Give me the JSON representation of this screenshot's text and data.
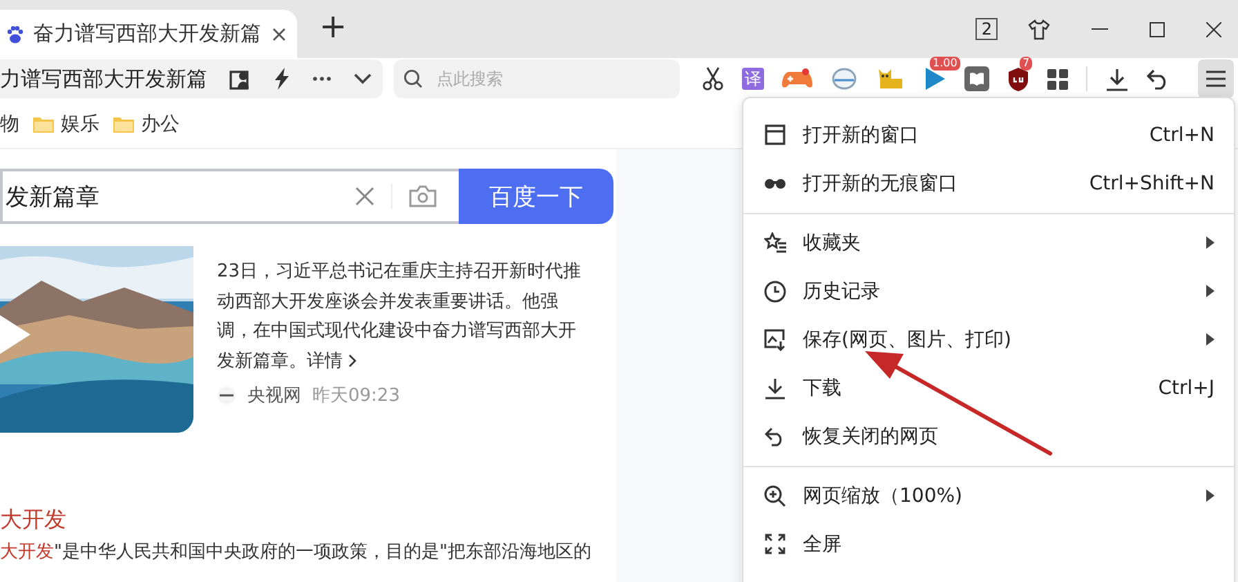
{
  "tab_bar": {
    "tabs": [
      {
        "title": "奋力谱写西部大开发新篇",
        "selected": true
      }
    ],
    "new_tab": "+",
    "tab_count": "2"
  },
  "toolbar": {
    "address": "力谱写西部大开发新篇",
    "search": {
      "placeholder": "点此搜索"
    },
    "extensions": [
      {
        "kind": "scissors"
      },
      {
        "kind": "translate",
        "label": "译"
      },
      {
        "kind": "game"
      },
      {
        "kind": "browser"
      },
      {
        "kind": "cat"
      },
      {
        "kind": "play",
        "badge": "1.00"
      },
      {
        "kind": "book"
      },
      {
        "kind": "shield",
        "badge": "7"
      },
      {
        "kind": "apps"
      }
    ]
  },
  "bookmarks": [
    {
      "label": "物",
      "folder": false
    },
    {
      "label": "娱乐",
      "folder": true
    },
    {
      "label": "办公",
      "folder": true
    }
  ],
  "search": {
    "value": "发新篇章",
    "button": "百度一下"
  },
  "news": {
    "body": "23日，习近平总书记在重庆主持召开新时代推动西部大开发座谈会并发表重要讲话。他强调，在中国式现代化建设中奋力谱写西部大开发新篇章。",
    "link": "详情",
    "source": "央视网",
    "time": "昨天09:23"
  },
  "result": {
    "title": "大开发",
    "highlight": "大开发",
    "snippet": "\"是中华人民共和国中央政府的一项政策，目的是\"把东部沿海地区的"
  },
  "menu": {
    "groups": [
      [
        {
          "kind": "window",
          "label": "打开新的窗口",
          "shortcut": "Ctrl+N",
          "submenu": false
        },
        {
          "kind": "incognito",
          "label": "打开新的无痕窗口",
          "shortcut": "Ctrl+Shift+N",
          "submenu": false
        }
      ],
      [
        {
          "kind": "favorites",
          "label": "收藏夹",
          "submenu": true
        },
        {
          "kind": "history",
          "label": "历史记录",
          "submenu": true
        },
        {
          "kind": "save",
          "label": "保存(网页、图片、打印)",
          "submenu": true
        },
        {
          "kind": "download",
          "label": "下载",
          "shortcut": "Ctrl+J",
          "submenu": false
        },
        {
          "kind": "restore",
          "label": "恢复关闭的网页",
          "submenu": false
        }
      ],
      [
        {
          "kind": "zoom",
          "label": "网页缩放（100%)",
          "submenu": true
        },
        {
          "kind": "fullscreen",
          "label": "全屏",
          "submenu": false
        }
      ]
    ]
  },
  "annotation": {
    "kind": "arrow"
  }
}
